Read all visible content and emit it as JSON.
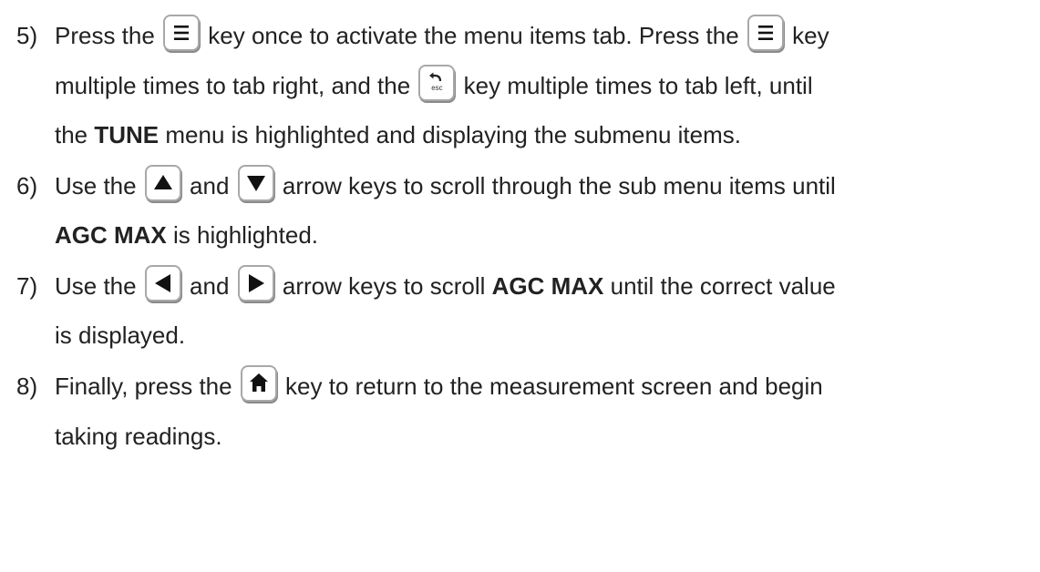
{
  "step5": {
    "number": "5)",
    "line1": {
      "a": "Press the ",
      "b": " key once to activate the menu items tab.  Press the ",
      "c": " key"
    },
    "line2": {
      "a": "multiple times to tab right, and the ",
      "b": " key multiple times to tab left, until"
    },
    "line3": {
      "a": "the ",
      "bold": "TUNE",
      "b": " menu is highlighted and displaying the submenu items."
    }
  },
  "step6": {
    "number": "6)",
    "line1": {
      "a": "Use the ",
      "b": " and ",
      "c": " arrow keys to scroll through the sub menu items until"
    },
    "line2": {
      "bold": "AGC MAX",
      "b": " is highlighted."
    }
  },
  "step7": {
    "number": "7)",
    "line1": {
      "a": "Use the ",
      "b": " and ",
      "c": "  arrow keys to scroll ",
      "bold": "AGC MAX",
      "d": " until the correct value"
    },
    "line2": {
      "a": "is displayed."
    }
  },
  "step8": {
    "number": "8)",
    "line1": {
      "a": "Finally, press the ",
      "b": " key to return to the measurement screen and begin"
    },
    "line2": {
      "a": "taking readings."
    }
  },
  "keys": {
    "menu": "menu-key-icon",
    "esc": "esc-back-key-icon",
    "esc_label": "esc",
    "up": "up-arrow-key-icon",
    "down": "down-arrow-key-icon",
    "left": "left-arrow-key-icon",
    "right": "right-arrow-key-icon",
    "home": "home-key-icon"
  },
  "colors": {
    "text": "#222222",
    "key_border": "#a8a8a8",
    "key_icon": "#111111"
  }
}
